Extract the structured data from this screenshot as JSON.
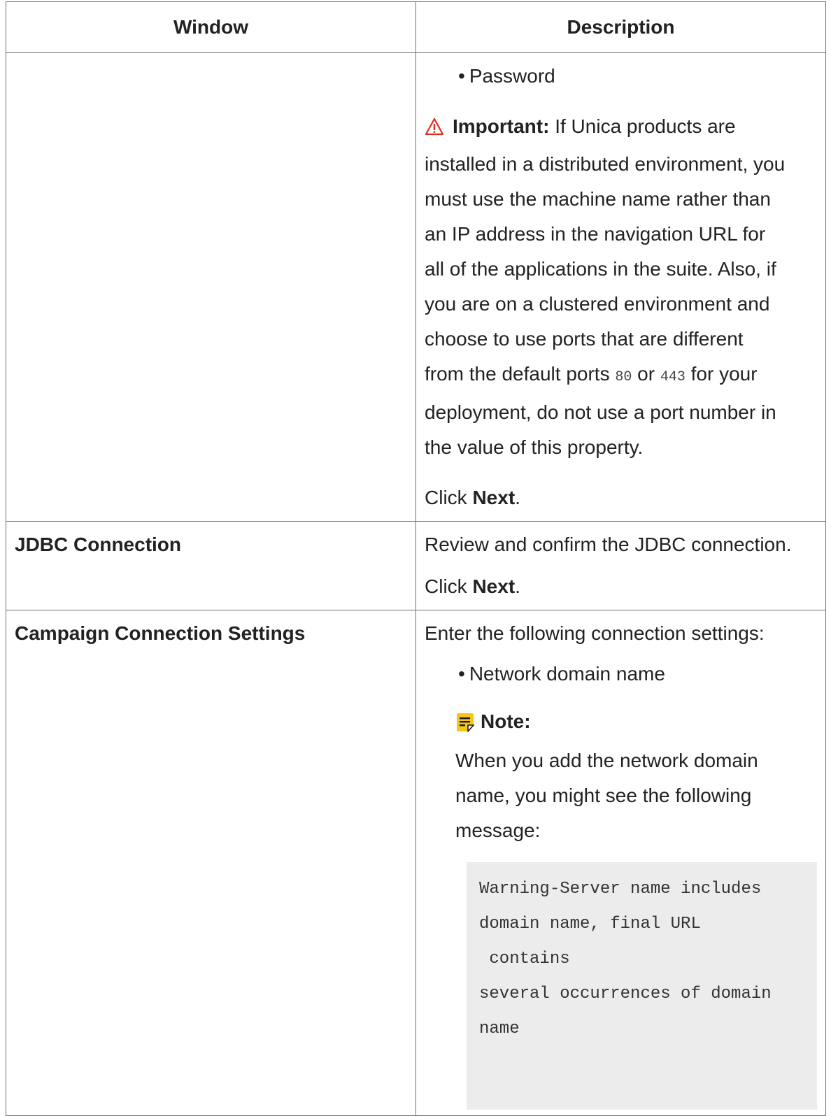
{
  "table": {
    "headers": [
      "Window",
      "Description"
    ],
    "row1": {
      "window": "",
      "bullet_password": "Password",
      "important_label": "Important:",
      "important_lines": [
        "If Unica products are",
        "installed in a distributed environment, you",
        "must use the machine name rather than",
        "an IP address in the navigation URL for",
        "all of the applications in the suite. Also, if",
        "you are on a clustered environment and",
        "choose to use ports that are different"
      ],
      "ports_prefix": "from the default ports",
      "port_a": "80",
      "port_or": "or",
      "port_b": "443",
      "ports_suffix": "for your",
      "important_tail": [
        "deployment, do not use a port number in",
        "the value of this property."
      ],
      "click": "Click",
      "next": "Next",
      "period": "."
    },
    "row2": {
      "window": "JDBC Connection",
      "text": "Review and confirm the JDBC connection.",
      "click": "Click",
      "next": "Next",
      "period": "."
    },
    "row3": {
      "window": "Campaign Connection Settings",
      "intro": "Enter the following connection settings:",
      "bullet_domain": "Network domain name",
      "note_label": "Note:",
      "note_lines": [
        "When you add the network domain",
        "name, you might see the following",
        "message:"
      ],
      "code_lines": [
        "Warning-Server name includes",
        "domain name, final URL",
        " contains",
        "several occurrences of domain",
        "name"
      ]
    }
  }
}
